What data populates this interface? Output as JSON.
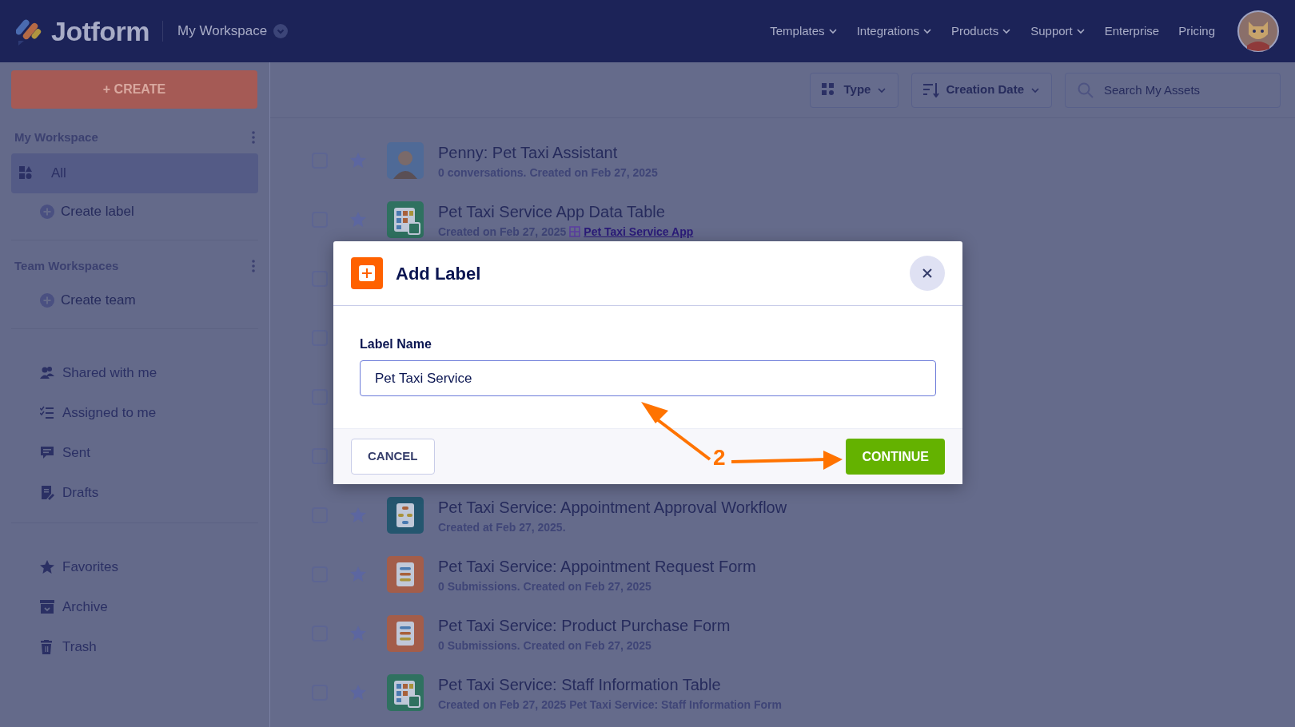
{
  "header": {
    "brand": "Jotform",
    "workspace": "My Workspace",
    "nav": [
      {
        "label": "Templates",
        "dropdown": true
      },
      {
        "label": "Integrations",
        "dropdown": true
      },
      {
        "label": "Products",
        "dropdown": true
      },
      {
        "label": "Support",
        "dropdown": true
      },
      {
        "label": "Enterprise",
        "dropdown": false
      },
      {
        "label": "Pricing",
        "dropdown": false
      }
    ]
  },
  "sidebar": {
    "create_button": "+ CREATE",
    "sections": [
      {
        "title": "My Workspace",
        "items": [
          {
            "label": "All",
            "kind": "nav",
            "selected": true
          },
          {
            "label": "Create label",
            "kind": "add"
          }
        ]
      },
      {
        "title": "Team Workspaces",
        "items": [
          {
            "label": "Create team",
            "kind": "add"
          }
        ]
      },
      {
        "items": [
          {
            "label": "Shared with me",
            "kind": "nav",
            "selected": false
          },
          {
            "label": "Assigned to me",
            "kind": "nav",
            "selected": false
          },
          {
            "label": "Sent",
            "kind": "nav",
            "selected": false
          },
          {
            "label": "Drafts",
            "kind": "nav",
            "selected": false
          }
        ]
      },
      {
        "items": [
          {
            "label": "Favorites",
            "kind": "nav",
            "selected": false
          },
          {
            "label": "Archive",
            "kind": "nav",
            "selected": false
          },
          {
            "label": "Trash",
            "kind": "nav",
            "selected": false
          }
        ]
      }
    ]
  },
  "toolbar": {
    "filters": [
      {
        "label": "Type"
      },
      {
        "label": "Creation Date"
      }
    ],
    "search": {
      "placeholder": "Search My Assets"
    }
  },
  "assets": [
    {
      "kind": "agent",
      "checked": false,
      "title": "Penny: Pet Taxi Assistant",
      "subtitle": "0 conversations. Created on Feb 27, 2025"
    },
    {
      "kind": "table",
      "checked": false,
      "title": "Pet Taxi Service App Data Table",
      "subtitle": "Created on Feb 27, 2025",
      "link": "Pet Taxi Service App"
    },
    {
      "kind": "covered",
      "checked": false
    },
    {
      "kind": "covered",
      "checked": false
    },
    {
      "kind": "covered",
      "checked": false
    },
    {
      "kind": "covered",
      "checked": false
    },
    {
      "kind": "workflow",
      "checked": false,
      "title": "Pet Taxi Service: Appointment Approval Workflow",
      "subtitle": "Created at Feb 27, 2025."
    },
    {
      "kind": "form",
      "checked": false,
      "title": "Pet Taxi Service: Appointment Request Form",
      "subtitle": "0 Submissions. Created on Feb 27, 2025"
    },
    {
      "kind": "form",
      "checked": false,
      "title": "Pet Taxi Service: Product Purchase Form",
      "subtitle": "0 Submissions. Created on Feb 27, 2025"
    },
    {
      "kind": "table",
      "checked": false,
      "title": "Pet Taxi Service: Staff Information Table",
      "subtitle": "Created on Feb 27, 2025 Pet Taxi Service: Staff Information Form"
    }
  ],
  "modal": {
    "title": "Add Label",
    "field_label": "Label Name",
    "value": "Pet Taxi Service",
    "cancel": "CANCEL",
    "continue": "CONTINUE"
  },
  "annotation": {
    "label": "2"
  }
}
